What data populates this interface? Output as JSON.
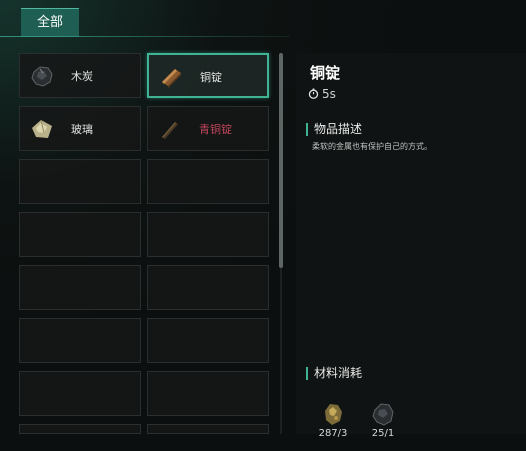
{
  "tabs": {
    "active_label": "全部"
  },
  "grid": {
    "items": [
      {
        "label": "木炭",
        "icon": "charcoal-icon",
        "locked": false,
        "selected": false
      },
      {
        "label": "铜锭",
        "icon": "copper-ingot-icon",
        "locked": false,
        "selected": true
      },
      {
        "label": "玻璃",
        "icon": "glass-icon",
        "locked": false,
        "selected": false
      },
      {
        "label": "青铜锭",
        "icon": "bronze-ingot-icon",
        "locked": true,
        "selected": false
      }
    ]
  },
  "detail": {
    "title": "铜锭",
    "time": "5s",
    "description_header": "物品描述",
    "description": "柔软的金属也有保护自己的方式。",
    "materials_header": "材料消耗",
    "materials": [
      {
        "icon": "copper-ore-icon",
        "count": "287/3"
      },
      {
        "icon": "charcoal-icon",
        "count": "25/1"
      }
    ]
  },
  "colors": {
    "accent": "#3fb394",
    "tab_bg": "#1f5e52",
    "locked_text": "#c0465a"
  }
}
